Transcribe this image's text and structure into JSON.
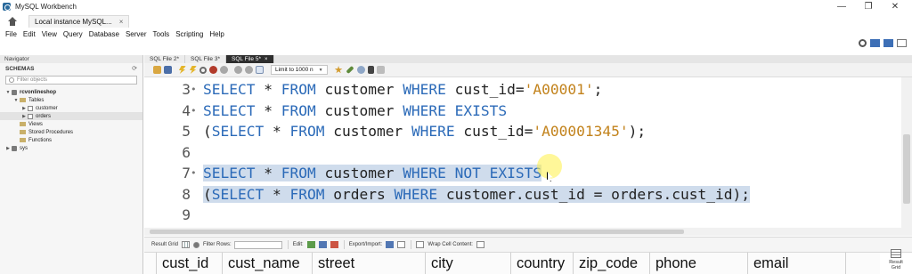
{
  "window": {
    "title": "MySQL Workbench",
    "minimize": "—",
    "maximize": "❐",
    "close": "✕"
  },
  "connection_tab": {
    "label": "Local instance MySQL...",
    "close": "×"
  },
  "menu": [
    "File",
    "Edit",
    "View",
    "Query",
    "Database",
    "Server",
    "Tools",
    "Scripting",
    "Help"
  ],
  "navigator": {
    "header": "Navigator",
    "schemas_label": "SCHEMAS",
    "refresh": "⟳",
    "filter_placeholder": "Filter objects",
    "tree": [
      {
        "label": "rcvonlineshop",
        "level": 0,
        "toggle": "▼",
        "kind": "db",
        "bold": true
      },
      {
        "label": "Tables",
        "level": 1,
        "toggle": "▼",
        "kind": "folder"
      },
      {
        "label": "customer",
        "level": 2,
        "toggle": "▶",
        "kind": "table"
      },
      {
        "label": "orders",
        "level": 2,
        "toggle": "▶",
        "kind": "table",
        "selected": true
      },
      {
        "label": "Views",
        "level": 1,
        "toggle": "",
        "kind": "folder"
      },
      {
        "label": "Stored Procedures",
        "level": 1,
        "toggle": "",
        "kind": "folder"
      },
      {
        "label": "Functions",
        "level": 1,
        "toggle": "",
        "kind": "folder"
      },
      {
        "label": "sys",
        "level": 0,
        "toggle": "▶",
        "kind": "db"
      }
    ]
  },
  "editor_tabs": [
    {
      "label": "SQL File 2*",
      "active": false
    },
    {
      "label": "SQL File 3*",
      "active": false
    },
    {
      "label": "SQL File 5*",
      "active": true,
      "close": "×"
    }
  ],
  "toolbar": {
    "limit_label": "Limit to 1000 n",
    "limit_dropdown": "▼"
  },
  "code": {
    "lines": [
      {
        "num": "3",
        "fold": "•",
        "highlight": false,
        "tokens": [
          {
            "t": "kw",
            "v": "SELECT"
          },
          {
            "t": "txt",
            "v": " * "
          },
          {
            "t": "kw",
            "v": "FROM"
          },
          {
            "t": "txt",
            "v": " customer "
          },
          {
            "t": "kw",
            "v": "WHERE"
          },
          {
            "t": "txt",
            "v": " cust_id="
          },
          {
            "t": "str",
            "v": "'A00001'"
          },
          {
            "t": "txt",
            "v": ";"
          }
        ]
      },
      {
        "num": "4",
        "fold": "•",
        "highlight": false,
        "tokens": [
          {
            "t": "kw",
            "v": "SELECT"
          },
          {
            "t": "txt",
            "v": " * "
          },
          {
            "t": "kw",
            "v": "FROM"
          },
          {
            "t": "txt",
            "v": " customer "
          },
          {
            "t": "kw",
            "v": "WHERE EXISTS"
          }
        ]
      },
      {
        "num": "5",
        "fold": "",
        "highlight": false,
        "tokens": [
          {
            "t": "txt",
            "v": "("
          },
          {
            "t": "kw",
            "v": "SELECT"
          },
          {
            "t": "txt",
            "v": " * "
          },
          {
            "t": "kw",
            "v": "FROM"
          },
          {
            "t": "txt",
            "v": " customer "
          },
          {
            "t": "kw",
            "v": "WHERE"
          },
          {
            "t": "txt",
            "v": " cust_id="
          },
          {
            "t": "str",
            "v": "'A00001345'"
          },
          {
            "t": "txt",
            "v": ");"
          }
        ]
      },
      {
        "num": "6",
        "fold": "",
        "highlight": false,
        "tokens": []
      },
      {
        "num": "7",
        "fold": "•",
        "highlight": true,
        "tokens": [
          {
            "t": "kw",
            "v": "SELECT"
          },
          {
            "t": "txt",
            "v": " * "
          },
          {
            "t": "kw",
            "v": "FROM"
          },
          {
            "t": "txt",
            "v": " customer "
          },
          {
            "t": "kw",
            "v": "WHERE NOT EXISTS"
          }
        ]
      },
      {
        "num": "8",
        "fold": "",
        "highlight": true,
        "tokens": [
          {
            "t": "txt",
            "v": "("
          },
          {
            "t": "kw",
            "v": "SELECT"
          },
          {
            "t": "txt",
            "v": " * "
          },
          {
            "t": "kw",
            "v": "FROM"
          },
          {
            "t": "txt",
            "v": " orders "
          },
          {
            "t": "kw",
            "v": "WHERE"
          },
          {
            "t": "txt",
            "v": " customer.cust_id = orders.cust_id);"
          }
        ]
      },
      {
        "num": "9",
        "fold": "",
        "highlight": false,
        "tokens": []
      }
    ]
  },
  "result_toolbar": {
    "result_grid": "Result Grid",
    "filter_rows": "Filter Rows:",
    "edit": "Edit:",
    "export_import": "Export/Import:",
    "wrap_cell": "Wrap Cell Content:",
    "side_button": "Result Grid"
  },
  "result_columns": [
    "cust_id",
    "cust_name",
    "street",
    "city",
    "country",
    "zip_code",
    "phone",
    "email"
  ],
  "colors": {
    "keyword": "#2b6ab8",
    "string": "#c2821b",
    "selection": "#cfdcec",
    "active_tab": "#2e2e2e"
  }
}
